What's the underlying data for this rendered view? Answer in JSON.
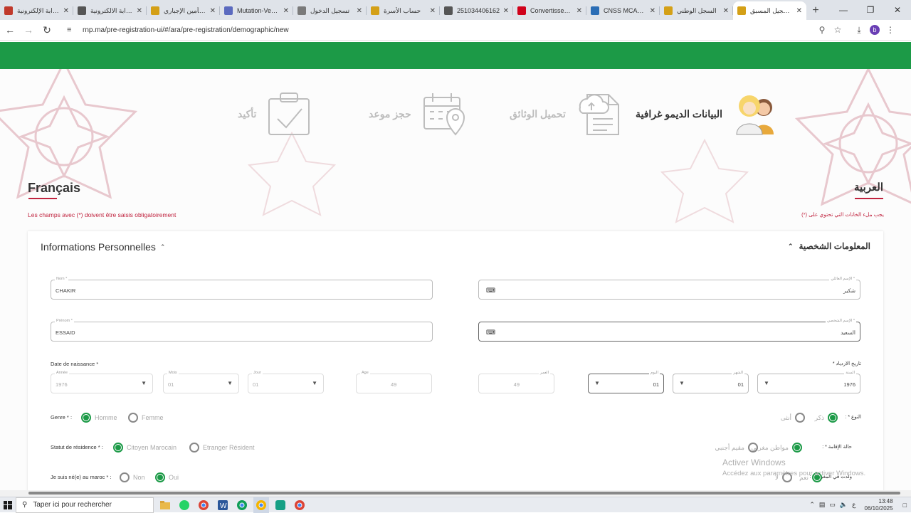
{
  "browser": {
    "tabs": [
      {
        "title": "البوابة الإلكترونية",
        "color": "#c0392b"
      },
      {
        "title": "البوابة الالكترونية",
        "color": "#555555"
      },
      {
        "title": "نظام التأمين الإجباري",
        "color": "#d4a017"
      },
      {
        "title": "Mutation-Vehicule",
        "color": "#5b6abf"
      },
      {
        "title": "تسجيل الدخول",
        "color": "#7a7a7a"
      },
      {
        "title": "حساب الأسرة",
        "color": "#d4a017"
      },
      {
        "title": "251034406162",
        "color": "#555555"
      },
      {
        "title": "Convertissez des fichiers",
        "color": "#d0021b"
      },
      {
        "title": "CNSS MCAL Portail",
        "color": "#2a6db5"
      },
      {
        "title": "السجل الوطني",
        "color": "#d4a017"
      },
      {
        "title": "التسجيل المسبق",
        "color": "#d4a017"
      }
    ],
    "active_tab": 10,
    "url": "rnp.ma/pre-registration-ui/#/ara/pre-registration/demographic/new",
    "profile_letter": "b"
  },
  "steps": [
    {
      "label": "البيانات الديمو غرافية",
      "icon": "family-icon",
      "active": true
    },
    {
      "label": "تحميل الوثائق",
      "icon": "document-upload-icon",
      "active": false
    },
    {
      "label": "حجز موعد",
      "icon": "calendar-location-icon",
      "active": false
    },
    {
      "label": "تأكيد",
      "icon": "clipboard-check-icon",
      "active": false
    }
  ],
  "lang": {
    "fr": "Français",
    "ar": "العربية"
  },
  "notes": {
    "fr": "Les champs avec (*) doivent être saisis obligatoirement",
    "ar": "يجب ملء الخانات التي تحتوي على (*)"
  },
  "section": {
    "fr": "Informations Personnelles",
    "ar": "المعلومات الشخصية"
  },
  "fields": {
    "nom": {
      "label": "Nom *",
      "value": "CHAKIR"
    },
    "prenom": {
      "label": "Prénom *",
      "value": "ESSAID"
    },
    "nom_ar": {
      "label": "الإسم العائلي *",
      "value": "شكير"
    },
    "prenom_ar": {
      "label": "الإسم الشخصي *",
      "value": "السعيد"
    },
    "dob_label": "Date de naissance *",
    "dob_label_ar": "تاريخ الازدياد *",
    "annee": {
      "label": "Année",
      "value": "1976"
    },
    "mois": {
      "label": "Mois",
      "value": "01"
    },
    "jour": {
      "label": "Jour",
      "value": "01"
    },
    "age": {
      "label": "Age",
      "value": "49"
    },
    "age_ar": {
      "label": "العمر",
      "value": "49"
    },
    "jour_ar": {
      "label": "اليوم",
      "value": "01"
    },
    "mois_ar": {
      "label": "الشهر",
      "value": "01"
    },
    "annee_ar": {
      "label": "السنة",
      "value": "1976"
    }
  },
  "genre": {
    "label": "Genre *",
    "options": [
      "Homme",
      "Femme"
    ],
    "selected": 0
  },
  "genre_ar": {
    "label": "النوع *",
    "options": [
      "ذكر",
      "أنثى"
    ],
    "selected": 0
  },
  "statut": {
    "label": "Statut de résidence *",
    "options": [
      "Citoyen Marocain",
      "Etranger Résident"
    ],
    "selected": 0
  },
  "statut_ar": {
    "label": "حالة الإقامة *",
    "options": [
      "مواطن مغربي",
      "مقيم أجنبي"
    ],
    "selected": 0
  },
  "ne_maroc": {
    "label": "Je suis né(e) au maroc *",
    "options": [
      "Non",
      "Oui"
    ],
    "selected": 1
  },
  "ne_maroc_ar": {
    "label": "ولدت في المغرب *",
    "options": [
      "نعم",
      "لا"
    ],
    "selected": 0
  },
  "watermark": {
    "line1": "Activer Windows",
    "line2": "Accédez aux paramètres pour activer Windows."
  },
  "taskbar": {
    "search_placeholder": "Taper ici pour rechercher",
    "lang_indicator": "ع",
    "time": "13:48",
    "date": "06/10/2025"
  },
  "colors": {
    "brand_green": "#1c9a47",
    "accent_red": "#c0233e"
  }
}
